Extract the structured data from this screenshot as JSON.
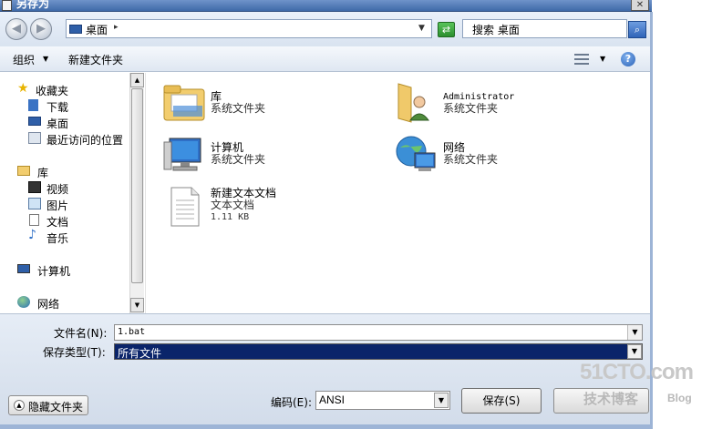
{
  "window": {
    "title": "另存为"
  },
  "address": {
    "location": "桌面",
    "search_placeholder": "搜索 桌面"
  },
  "toolbar": {
    "organize": "组织",
    "new_folder": "新建文件夹"
  },
  "nav": {
    "favorites": "收藏夹",
    "downloads": "下载",
    "desktop": "桌面",
    "recent": "最近访问的位置",
    "libraries": "库",
    "videos": "视频",
    "pictures": "图片",
    "documents": "文档",
    "music": "音乐",
    "computer": "计算机",
    "network": "网络"
  },
  "files": [
    {
      "name": "库",
      "type": "系统文件夹"
    },
    {
      "name": "Administrator",
      "type": "系统文件夹"
    },
    {
      "name": "计算机",
      "type": "系统文件夹"
    },
    {
      "name": "网络",
      "type": "系统文件夹"
    },
    {
      "name": "新建文本文档",
      "type": "文本文档",
      "size": "1.11 KB"
    }
  ],
  "form": {
    "filename_label": "文件名(N):",
    "filename_value": "1.bat",
    "filetype_label": "保存类型(T):",
    "filetype_value": "所有文件",
    "hide_folders": "隐藏文件夹",
    "encoding_label": "编码(E):",
    "encoding_value": "ANSI",
    "save": "保存(S)"
  },
  "watermark": {
    "main": "51CTO.com",
    "sub": "技术博客",
    "blog": "Blog"
  }
}
